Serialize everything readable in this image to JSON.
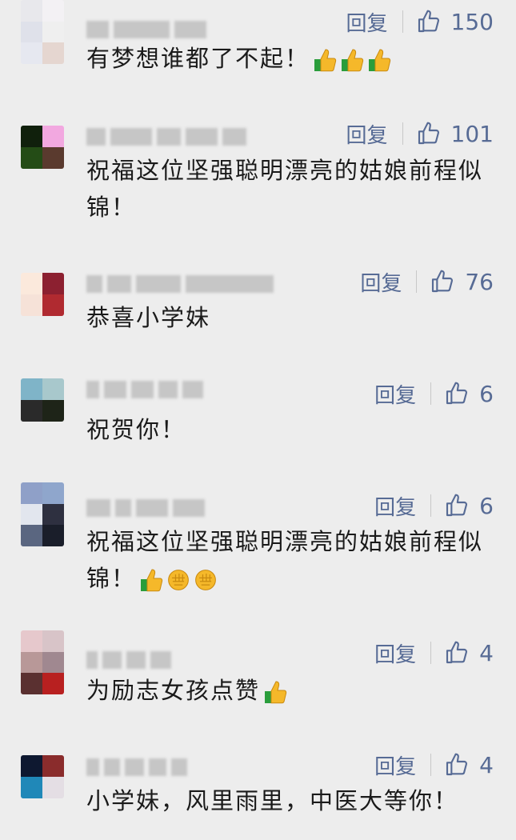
{
  "reply_label": "回复",
  "comments": [
    {
      "content": "有梦想谁都了不起！",
      "likes": "150",
      "emoji_icons": [
        "thumbs-up-icon",
        "thumbs-up-icon",
        "thumbs-up-icon"
      ]
    },
    {
      "content": "祝福这位坚强聪明漂亮的姑娘前程似锦！",
      "likes": "101",
      "emoji_icons": []
    },
    {
      "content": "恭喜小学妹",
      "likes": "76",
      "emoji_icons": []
    },
    {
      "content": "祝贺你！",
      "likes": "6",
      "emoji_icons": []
    },
    {
      "content": "祝福这位坚强聪明漂亮的姑娘前程似锦！",
      "likes": "6",
      "emoji_icons": [
        "thumbs-up-icon",
        "fist-icon",
        "fist-icon"
      ]
    },
    {
      "content": "为励志女孩点赞",
      "likes": "4",
      "emoji_icons": [
        "thumbs-up-icon"
      ]
    },
    {
      "content": "小学妹，风里雨里，中医大等你！",
      "likes": "4",
      "emoji_icons": []
    }
  ],
  "colors": {
    "background": "#ededed",
    "link_blue": "#576b95",
    "text": "#1a1a1a"
  }
}
